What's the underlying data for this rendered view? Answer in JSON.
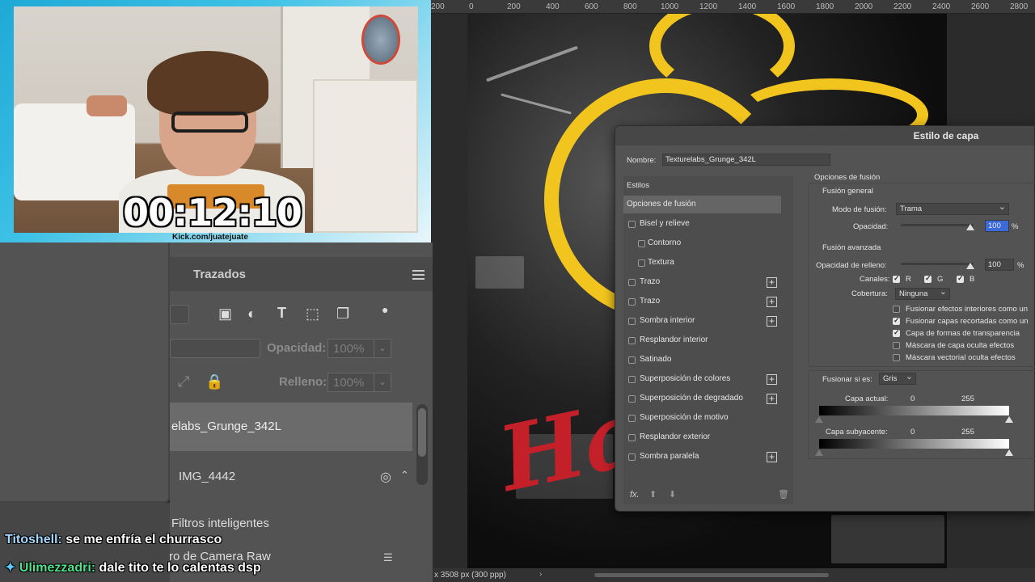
{
  "stream": {
    "timer": "00:12:10",
    "url": "Kick.com/juatejuate"
  },
  "chat": [
    {
      "user": "Titoshell:",
      "message": " se me enfría el churrasco"
    },
    {
      "user": "Ulimezzadri:",
      "message": " dale tito te lo calentas dsp"
    }
  ],
  "layers_panel": {
    "tab": "Trazados",
    "opacity_label": "Opacidad:",
    "opacity_value": "100%",
    "fill_label": "Relleno:",
    "fill_value": "100%",
    "layers": [
      {
        "name": "elabs_Grunge_342L"
      },
      {
        "name": "IMG_4442"
      },
      {
        "name": "Filtros inteligentes"
      },
      {
        "name": "Filtro de Camera Raw"
      }
    ]
  },
  "ruler": {
    "labels": [
      "200",
      "0",
      "200",
      "400",
      "600",
      "800",
      "1000",
      "1200",
      "1400",
      "1600",
      "1800",
      "2000",
      "2200",
      "2400",
      "2600",
      "2800"
    ]
  },
  "status": {
    "doc_size": "x 3508 px (300 ppp)"
  },
  "canvas": {
    "red_text": "Ha"
  },
  "dialog": {
    "title": "Estilo de capa",
    "name_label": "Nombre:",
    "name_value": "Texturelabs_Grunge_342L",
    "styles_header": "Estilos",
    "styles": [
      {
        "label": "Opciones de fusión",
        "checkbox": false,
        "plus": false,
        "selected": true,
        "indent": false
      },
      {
        "label": "Bisel y relieve",
        "checkbox": true,
        "plus": false,
        "selected": false,
        "indent": false
      },
      {
        "label": "Contorno",
        "checkbox": true,
        "plus": false,
        "selected": false,
        "indent": true
      },
      {
        "label": "Textura",
        "checkbox": true,
        "plus": false,
        "selected": false,
        "indent": true
      },
      {
        "label": "Trazo",
        "checkbox": true,
        "plus": true,
        "selected": false,
        "indent": false
      },
      {
        "label": "Trazo",
        "checkbox": true,
        "plus": true,
        "selected": false,
        "indent": false
      },
      {
        "label": "Sombra interior",
        "checkbox": true,
        "plus": true,
        "selected": false,
        "indent": false
      },
      {
        "label": "Resplandor interior",
        "checkbox": true,
        "plus": false,
        "selected": false,
        "indent": false
      },
      {
        "label": "Satinado",
        "checkbox": true,
        "plus": false,
        "selected": false,
        "indent": false
      },
      {
        "label": "Superposición de colores",
        "checkbox": true,
        "plus": true,
        "selected": false,
        "indent": false
      },
      {
        "label": "Superposición de degradado",
        "checkbox": true,
        "plus": true,
        "selected": false,
        "indent": false
      },
      {
        "label": "Superposición de motivo",
        "checkbox": true,
        "plus": false,
        "selected": false,
        "indent": false
      },
      {
        "label": "Resplandor exterior",
        "checkbox": true,
        "plus": false,
        "selected": false,
        "indent": false
      },
      {
        "label": "Sombra paralela",
        "checkbox": true,
        "plus": true,
        "selected": false,
        "indent": false
      }
    ],
    "fx_label": "fx.",
    "blend_options_title": "Opciones de fusión",
    "general_title": "Fusión general",
    "blend_mode_label": "Modo de fusión:",
    "blend_mode_value": "Trama",
    "opacity_label": "Opacidad:",
    "opacity_value": "100",
    "percent": "%",
    "advanced_title": "Fusión avanzada",
    "fill_opacity_label": "Opacidad de relleno:",
    "fill_opacity_value": "100",
    "channels_label": "Canales:",
    "channel_r": "R",
    "channel_g": "G",
    "channel_b": "B",
    "knockout_label": "Cobertura:",
    "knockout_value": "Ninguna",
    "checks": [
      {
        "label": "Fusionar efectos interiores como un",
        "checked": false
      },
      {
        "label": "Fusionar capas recortadas como un",
        "checked": true
      },
      {
        "label": "Capa de formas de transparencia",
        "checked": true
      },
      {
        "label": "Máscara de capa oculta efectos",
        "checked": false
      },
      {
        "label": "Máscara vectorial oculta efectos",
        "checked": false
      }
    ],
    "blend_if_label": "Fusionar si es:",
    "blend_if_value": "Gris",
    "current_layer_label": "Capa actual:",
    "current_min": "0",
    "current_max": "255",
    "underlying_layer_label": "Capa subyacente:",
    "underlying_min": "0",
    "underlying_max": "255"
  },
  "colors": {
    "accent_yellow": "#f2c51e",
    "accent_red": "#c4202a",
    "kick_cyan": "#1ea9d6"
  }
}
